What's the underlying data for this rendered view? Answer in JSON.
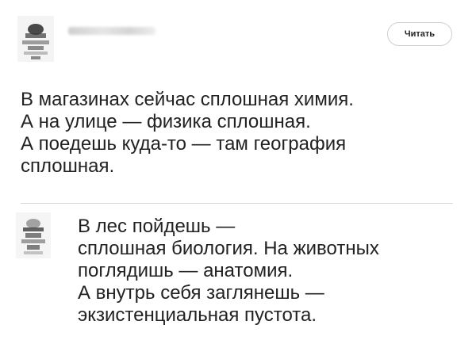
{
  "post": {
    "follow_button_label": "Читать",
    "text_lines": [
      "В магазинах сейчас сплошная химия.",
      "А на улице — физика сплошная.",
      "А поедешь куда-то — там география",
      "сплошная."
    ]
  },
  "comment": {
    "text_lines": [
      "В лес пойдешь —",
      "сплошная биология. На животных",
      "поглядишь — анатомия.",
      "А внутрь себя заглянешь —",
      "экзистенциальная пустота."
    ]
  }
}
